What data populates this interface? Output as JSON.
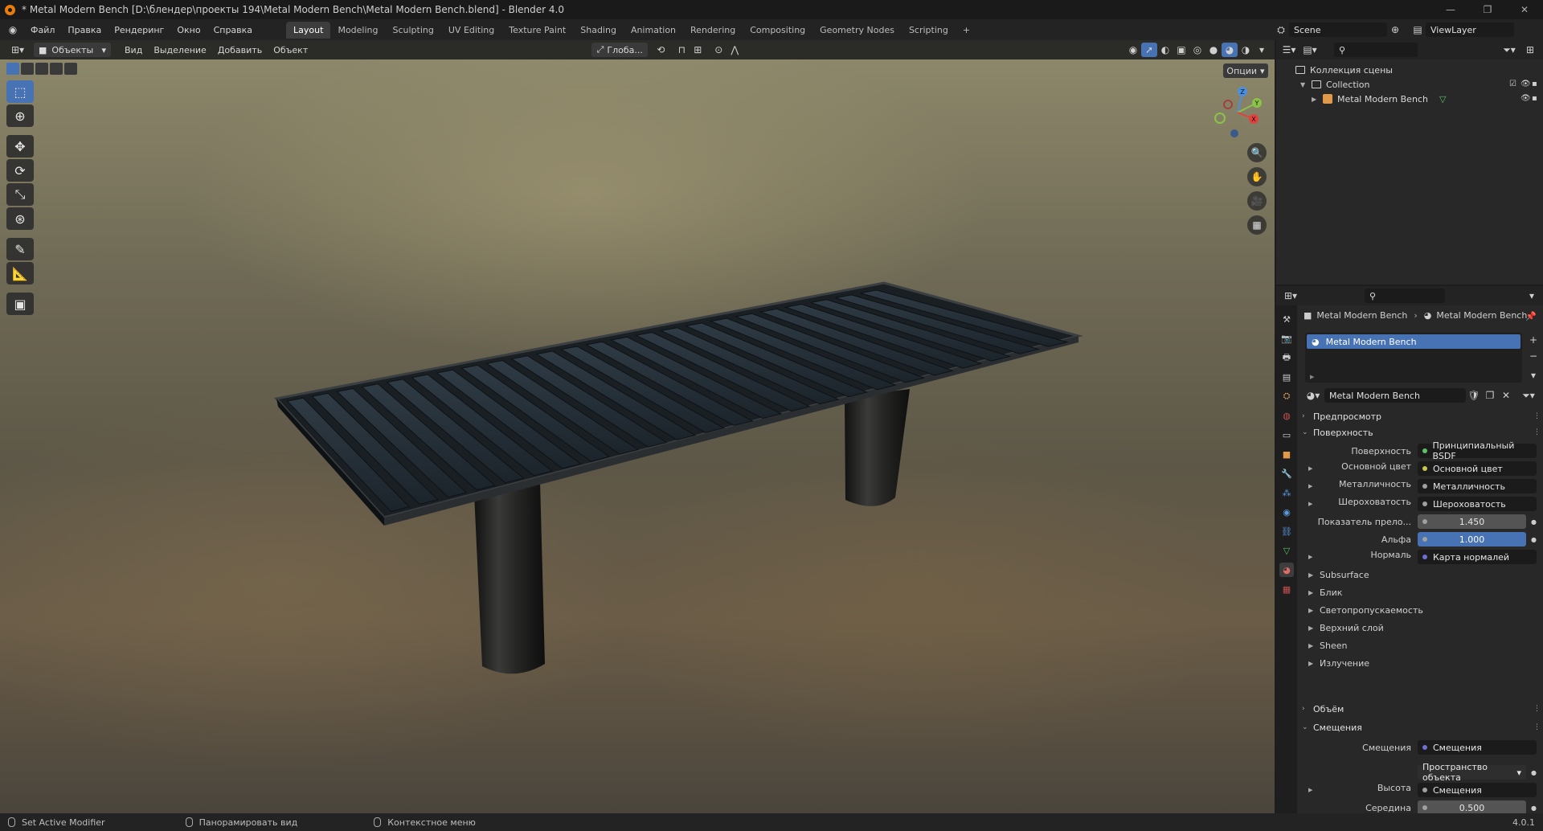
{
  "window": {
    "title": "* Metal Modern Bench [D:\\блендер\\проекты 194\\Metal Modern Bench\\Metal Modern Bench.blend] - Blender 4.0",
    "controls": [
      "—",
      "❐",
      "✕"
    ]
  },
  "menubar": {
    "menus": [
      "Файл",
      "Правка",
      "Рендеринг",
      "Окно",
      "Справка"
    ],
    "workspaces": [
      {
        "label": "Layout",
        "active": true
      },
      {
        "label": "Modeling"
      },
      {
        "label": "Sculpting"
      },
      {
        "label": "UV Editing"
      },
      {
        "label": "Texture Paint"
      },
      {
        "label": "Shading"
      },
      {
        "label": "Animation"
      },
      {
        "label": "Rendering"
      },
      {
        "label": "Compositing"
      },
      {
        "label": "Geometry Nodes"
      },
      {
        "label": "Scripting"
      }
    ],
    "add_tab": "+",
    "scene": "Scene",
    "view_layer": "ViewLayer"
  },
  "viewport": {
    "mode": "Объекты",
    "menus": [
      "Вид",
      "Выделение",
      "Добавить",
      "Объект"
    ],
    "transform_orientation": "Глоба...",
    "options_label": "Опции",
    "gizmo_axes": {
      "x": "X",
      "y": "Y",
      "z": "Z"
    },
    "colors": {
      "x": "#e2413f",
      "y": "#8bc34a",
      "z": "#4a8fe0",
      "accent": "#4772b3"
    }
  },
  "outliner": {
    "scene_collection": "Коллекция сцены",
    "collection": "Collection",
    "object": "Metal Modern Bench"
  },
  "properties": {
    "breadcrumb": [
      "Metal Modern Bench",
      "Metal Modern Bench"
    ],
    "slot": "Metal Modern Bench",
    "material_name": "Metal Modern Bench",
    "sections": {
      "preview": "Предпросмотр",
      "surface": "Поверхность",
      "volume": "Объём",
      "displacement": "Смещения"
    },
    "surface_rows": [
      {
        "label": "Поверхность",
        "value": "Принципиальный BSDF",
        "dot": "#59c264"
      },
      {
        "label": "Основной цвет",
        "value": "Основной цвет",
        "dot": "#c8c84a",
        "expand": true
      },
      {
        "label": "Металличность",
        "value": "Металличность",
        "dot": "#a0a0a0",
        "expand": true
      },
      {
        "label": "Шероховатость",
        "value": "Шероховатость",
        "dot": "#a0a0a0",
        "expand": true
      },
      {
        "label": "Показатель прело...",
        "value": "1.450",
        "dot": "#a0a0a0",
        "kind": "num"
      },
      {
        "label": "Альфа",
        "value": "1.000",
        "dot": "#a0a0a0",
        "kind": "blue"
      },
      {
        "label": "Нормаль",
        "value": "Карта нормалей",
        "dot": "#6f6fd0",
        "expand": true
      }
    ],
    "subpanels": [
      "Subsurface",
      "Блик",
      "Светопропускаемость",
      "Верхний слой",
      "Sheen",
      "Излучение"
    ],
    "displacement_rows": [
      {
        "label": "Смещения",
        "value": "Смещения",
        "dot": "#6f6fd0"
      },
      {
        "label": "",
        "value": "Пространство объекта",
        "kind": "dropdown"
      },
      {
        "label": "Высота",
        "value": "Смещения",
        "dot": "#a0a0a0",
        "expand": true
      },
      {
        "label": "Середина",
        "value": "0.500",
        "dot": "#a0a0a0",
        "kind": "num"
      }
    ]
  },
  "statusbar": {
    "items": [
      "Set Active Modifier",
      "Панорамировать вид",
      "Контекстное меню"
    ],
    "version": "4.0.1"
  }
}
